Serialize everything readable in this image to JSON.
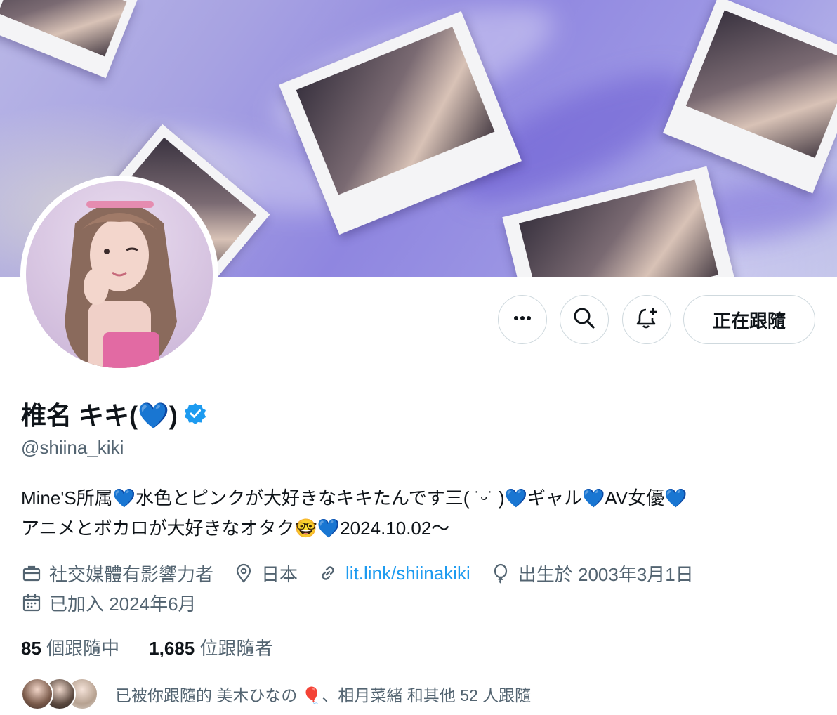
{
  "profile": {
    "display_name": "椎名 キキ(💙)",
    "handle": "@shiina_kiki",
    "bio_line1": "Mine'S所属💙水色とピンクが大好きなキキたんです三( ˙ᵕ˙ )💙ギャル💙AV女優💙",
    "bio_line2": "アニメとボカロが大好きなオタク🤓💙2024.10.02～",
    "category": "社交媒體有影響力者",
    "location": "日本",
    "website": "lit.link/shiinakiki",
    "birthday": "出生於 2003年3月1日",
    "joined": "已加入 2024年6月"
  },
  "actions": {
    "more_icon": "more-icon",
    "search_icon": "search-icon",
    "notify_icon": "bell-plus-icon",
    "follow_label": "正在跟隨"
  },
  "stats": {
    "following_count": "85",
    "following_label": "個跟隨中",
    "followers_count": "1,685",
    "followers_label": "位跟隨者"
  },
  "followed_by": {
    "text": "已被你跟隨的 美木ひなの 🎈、相月菜緒 和其他 52 人跟隨"
  },
  "colors": {
    "accent": "#1d9bf0",
    "verified": "#1d9bf0",
    "secondary_text": "#536471",
    "heart": "#8ec9f5"
  }
}
